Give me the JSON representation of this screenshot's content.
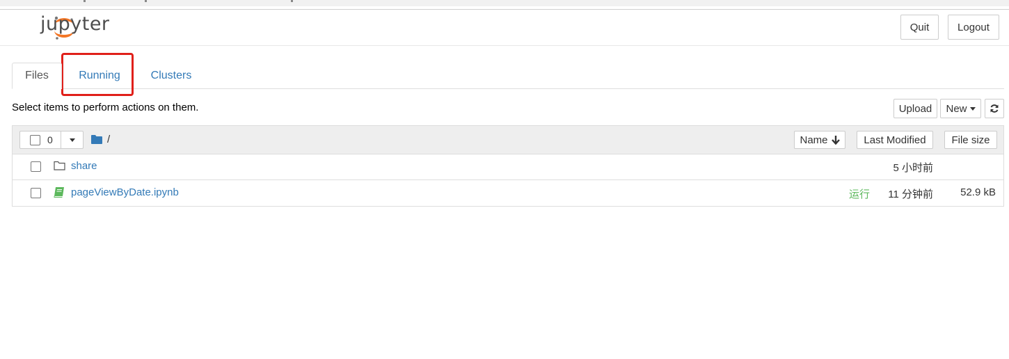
{
  "header": {
    "logo_text": "jupyter",
    "quit_label": "Quit",
    "logout_label": "Logout"
  },
  "tabs": [
    {
      "label": "Files"
    },
    {
      "label": "Running"
    },
    {
      "label": "Clusters"
    }
  ],
  "toolbar": {
    "instruction": "Select items to perform actions on them.",
    "upload_label": "Upload",
    "new_label": "New",
    "refresh_icon": "refresh-icon"
  },
  "list_header": {
    "selected_count": "0",
    "path": "/",
    "sort_name_label": "Name",
    "last_modified_label": "Last Modified",
    "file_size_label": "File size"
  },
  "files": [
    {
      "name": "share",
      "icon": "folder-icon",
      "status": "",
      "modified": "5 小时前",
      "size": ""
    },
    {
      "name": "pageViewByDate.ipynb",
      "icon": "notebook-icon",
      "status": "运行",
      "modified": "11 分钟前",
      "size": "52.9 kB"
    }
  ],
  "colors": {
    "link": "#337ab7",
    "running": "#5cb85c",
    "highlight": "#e0201a"
  }
}
